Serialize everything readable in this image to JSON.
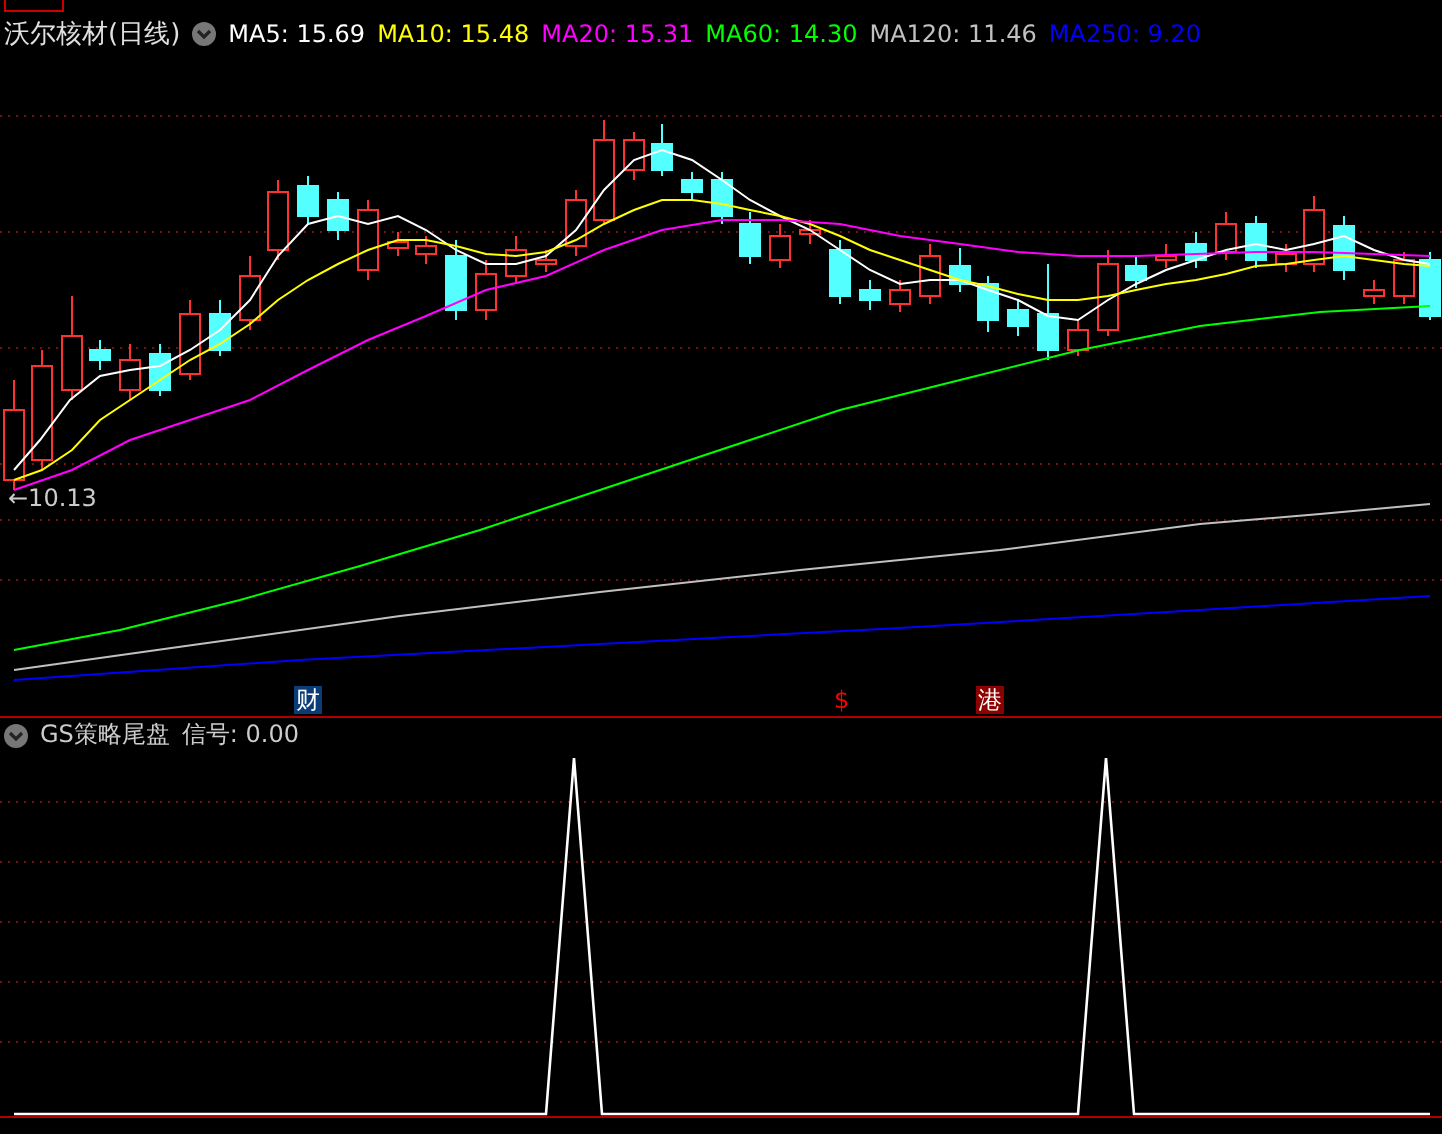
{
  "title": "沃尔核材(日线)",
  "moving_averages": [
    {
      "label": "MA5:",
      "value": "15.69",
      "color": "#ffffff"
    },
    {
      "label": "MA10:",
      "value": "15.48",
      "color": "#ffff00"
    },
    {
      "label": "MA20:",
      "value": "15.31",
      "color": "#ff00ff"
    },
    {
      "label": "MA60:",
      "value": "14.30",
      "color": "#00ff00"
    },
    {
      "label": "MA120:",
      "value": "11.46",
      "color": "#c0c0c0"
    },
    {
      "label": "MA250:",
      "value": "9.20",
      "color": "#0000ff"
    }
  ],
  "low_marker": "←10.13",
  "event_markers": [
    {
      "text": "财",
      "kind": "badge",
      "color": "#0a3c78"
    },
    {
      "text": "$",
      "kind": "text",
      "color": "#ff0000"
    },
    {
      "text": "港",
      "kind": "badge",
      "color": "#8b0000"
    }
  ],
  "indicator": {
    "name": "GS策略尾盘",
    "reading": "信号: 0.00"
  }
}
